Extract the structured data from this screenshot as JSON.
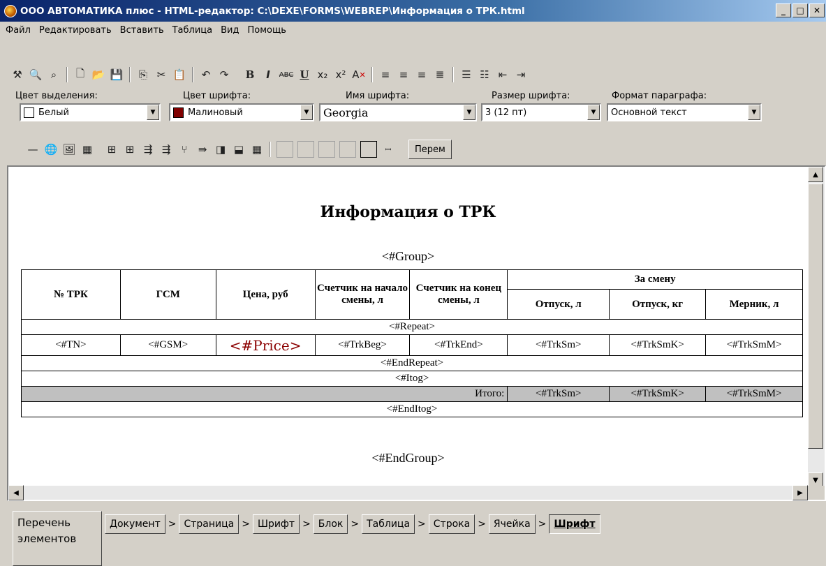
{
  "window": {
    "title": "ООО АВТОМАТИКА плюс - HTML-редактор: C:\\DEXE\\FORMS\\WEBREP\\Информация о ТРК.html"
  },
  "menu": [
    "Файл",
    "Редактировать",
    "Вставить",
    "Таблица",
    "Вид",
    "Помощь"
  ],
  "format": {
    "labels": {
      "highlight": "Цвет выделения:",
      "font_color": "Цвет шрифта:",
      "font_name": "Имя шрифта:",
      "font_size": "Размер шрифта:",
      "paragraph": "Формат параграфа:"
    },
    "values": {
      "highlight": "Белый",
      "font_color": "Малиновый",
      "font_name": "Georgia",
      "font_size": "3 (12 пт)",
      "paragraph": "Основной текст"
    },
    "colors": {
      "highlight_swatch": "#ffffff",
      "font_color_swatch": "#800000"
    }
  },
  "toolbar": {
    "perem_label": "Перем"
  },
  "document": {
    "title": "Информация о ТРК",
    "group": "<#Group>",
    "end_group": "<#EndGroup>",
    "headers": {
      "trk": "№ ТРК",
      "gsm": "ГСМ",
      "price": "Цена, руб",
      "start": "Счетчик на начало смены, л",
      "end": "Счетчик на конец смены, л",
      "shift": "За смену",
      "rel_l": "Отпуск, л",
      "rel_kg": "Отпуск, кг",
      "mern": "Мерник, л"
    },
    "repeat": "<#Repeat>",
    "row": [
      "<#TN>",
      "<#GSM>",
      "<#Price>",
      "<#TrkBeg>",
      "<#TrkEnd>",
      "<#TrkSm>",
      "<#TrkSmK>",
      "<#TrkSmM>"
    ],
    "end_repeat": "<#EndRepeat>",
    "itog": "<#Itog>",
    "itogo_label": "Итого:",
    "itog_row": [
      "<#TrkSm>",
      "<#TrkSmK>",
      "<#TrkSmM>"
    ],
    "end_itog": "<#EndItog>"
  },
  "bottom": {
    "panel_tab": "Перечень элементов",
    "breadcrumbs": [
      "Документ",
      "Страница",
      "Шрифт",
      "Блок",
      "Таблица",
      "Строка",
      "Ячейка",
      "Шрифт"
    ]
  }
}
